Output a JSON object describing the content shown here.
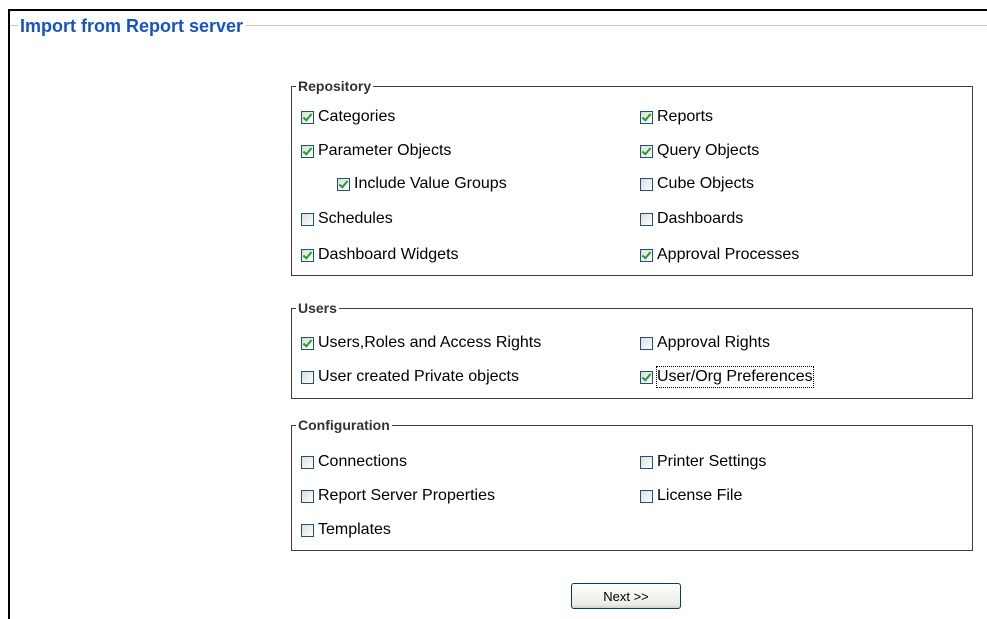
{
  "header": {
    "title": "Import from Report server"
  },
  "groups": {
    "repository": {
      "legend": "Repository",
      "items": [
        {
          "label": "Categories",
          "checked": true
        },
        {
          "label": "Reports",
          "checked": true
        },
        {
          "label": "Parameter Objects",
          "checked": true
        },
        {
          "label": "Query Objects",
          "checked": true
        },
        {
          "label": "Include Value Groups",
          "checked": true
        },
        {
          "label": "Cube Objects",
          "checked": false
        },
        {
          "label": "Schedules",
          "checked": false
        },
        {
          "label": "Dashboards",
          "checked": false
        },
        {
          "label": "Dashboard Widgets",
          "checked": true
        },
        {
          "label": "Approval Processes",
          "checked": true
        }
      ]
    },
    "users": {
      "legend": "Users",
      "items": [
        {
          "label": "Users,Roles and Access Rights",
          "checked": true
        },
        {
          "label": "Approval Rights",
          "checked": false
        },
        {
          "label": "User created Private objects",
          "checked": false
        },
        {
          "label": "User/Org Preferences",
          "checked": true
        }
      ]
    },
    "configuration": {
      "legend": "Configuration",
      "items": [
        {
          "label": "Connections",
          "checked": false
        },
        {
          "label": "Printer Settings",
          "checked": false
        },
        {
          "label": "Report Server Properties",
          "checked": false
        },
        {
          "label": "License File",
          "checked": false
        },
        {
          "label": "Templates",
          "checked": false
        }
      ]
    }
  },
  "footer": {
    "next_label": "Next >>"
  },
  "colors": {
    "title": "#1652c8",
    "checkmark": "#21a121",
    "checkbox_border": "#1c5180"
  }
}
